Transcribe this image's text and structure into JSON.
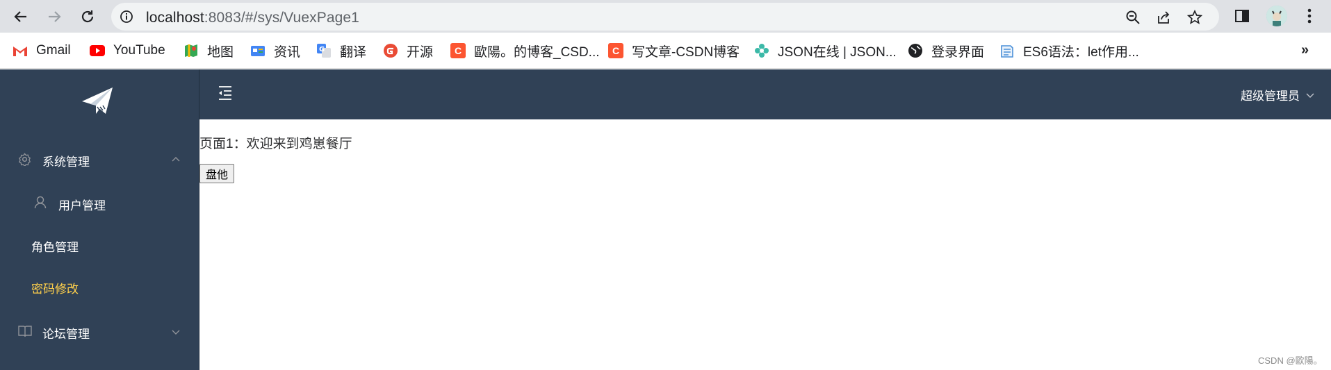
{
  "browser": {
    "url_host": "localhost",
    "url_path": ":8083/#/sys/VuexPage1",
    "bookmarks": [
      {
        "label": "Gmail",
        "icon": "gmail-icon",
        "color": "#ea4335"
      },
      {
        "label": "YouTube",
        "icon": "youtube-icon",
        "color": "#ff0000"
      },
      {
        "label": "地图",
        "icon": "maps-icon",
        "color": "#34a853"
      },
      {
        "label": "资讯",
        "icon": "news-icon",
        "color": "#4285f4"
      },
      {
        "label": "翻译",
        "icon": "translate-icon",
        "color": "#4285f4"
      },
      {
        "label": "开源",
        "icon": "gitee-icon",
        "color": "#e94b35"
      },
      {
        "label": "歐陽。的博客_CSD...",
        "icon": "csdn-icon",
        "color": "#fc5531"
      },
      {
        "label": "写文章-CSDN博客",
        "icon": "csdn-icon",
        "color": "#fc5531"
      },
      {
        "label": "JSON在线 | JSON...",
        "icon": "json-icon",
        "color": "#3cb9a8"
      },
      {
        "label": "登录界面",
        "icon": "globe-icon",
        "color": "#202124"
      },
      {
        "label": "ES6语法：let作用...",
        "icon": "doc-icon",
        "color": "#4a8fd8"
      }
    ],
    "more": "»"
  },
  "sidebar": {
    "menus": [
      {
        "label": "系统管理",
        "icon": "gear-icon",
        "expanded": true
      },
      {
        "label": "论坛管理",
        "icon": "book-icon",
        "expanded": false
      }
    ],
    "sub_items": [
      {
        "label": "用户管理",
        "icon": "user-icon",
        "active": false
      },
      {
        "label": "角色管理",
        "active": false
      },
      {
        "label": "密码修改",
        "active": true
      }
    ],
    "active_color": "#ffd04b"
  },
  "navbar": {
    "user": "超级管理员"
  },
  "content": {
    "welcome": "页面1：欢迎来到鸡崽餐厅",
    "button": "盘他"
  },
  "watermark": "CSDN @歐陽。"
}
